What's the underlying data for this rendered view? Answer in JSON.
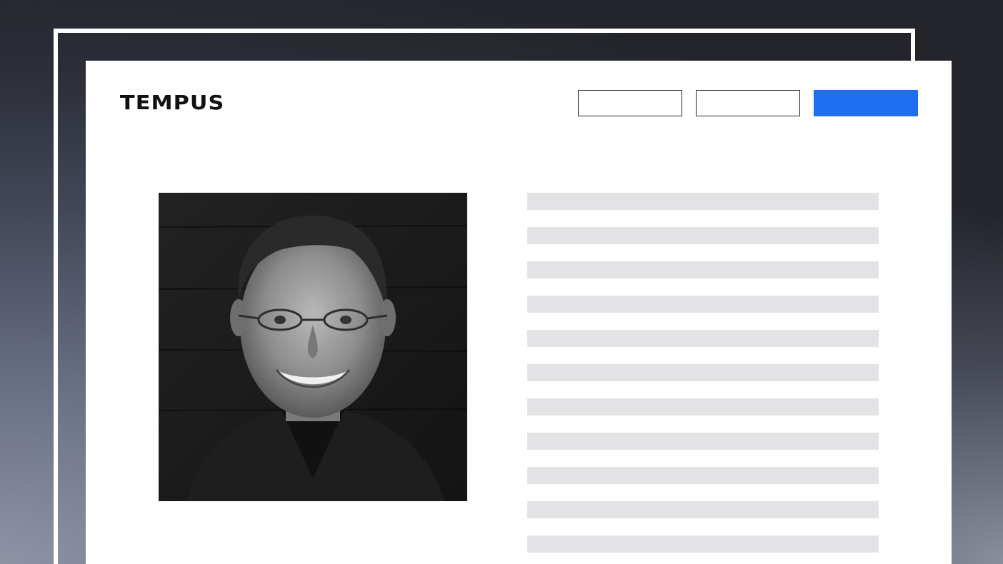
{
  "brand": {
    "logo_text": "TEMPUS"
  },
  "header": {
    "nav_buttons": [
      "",
      ""
    ],
    "cta_button": "",
    "cta_color": "#1f6ef0"
  },
  "profile": {
    "photo": "portrait-photo"
  },
  "content": {
    "placeholder_line_count": 11,
    "placeholder_color": "#e3e3e5"
  }
}
